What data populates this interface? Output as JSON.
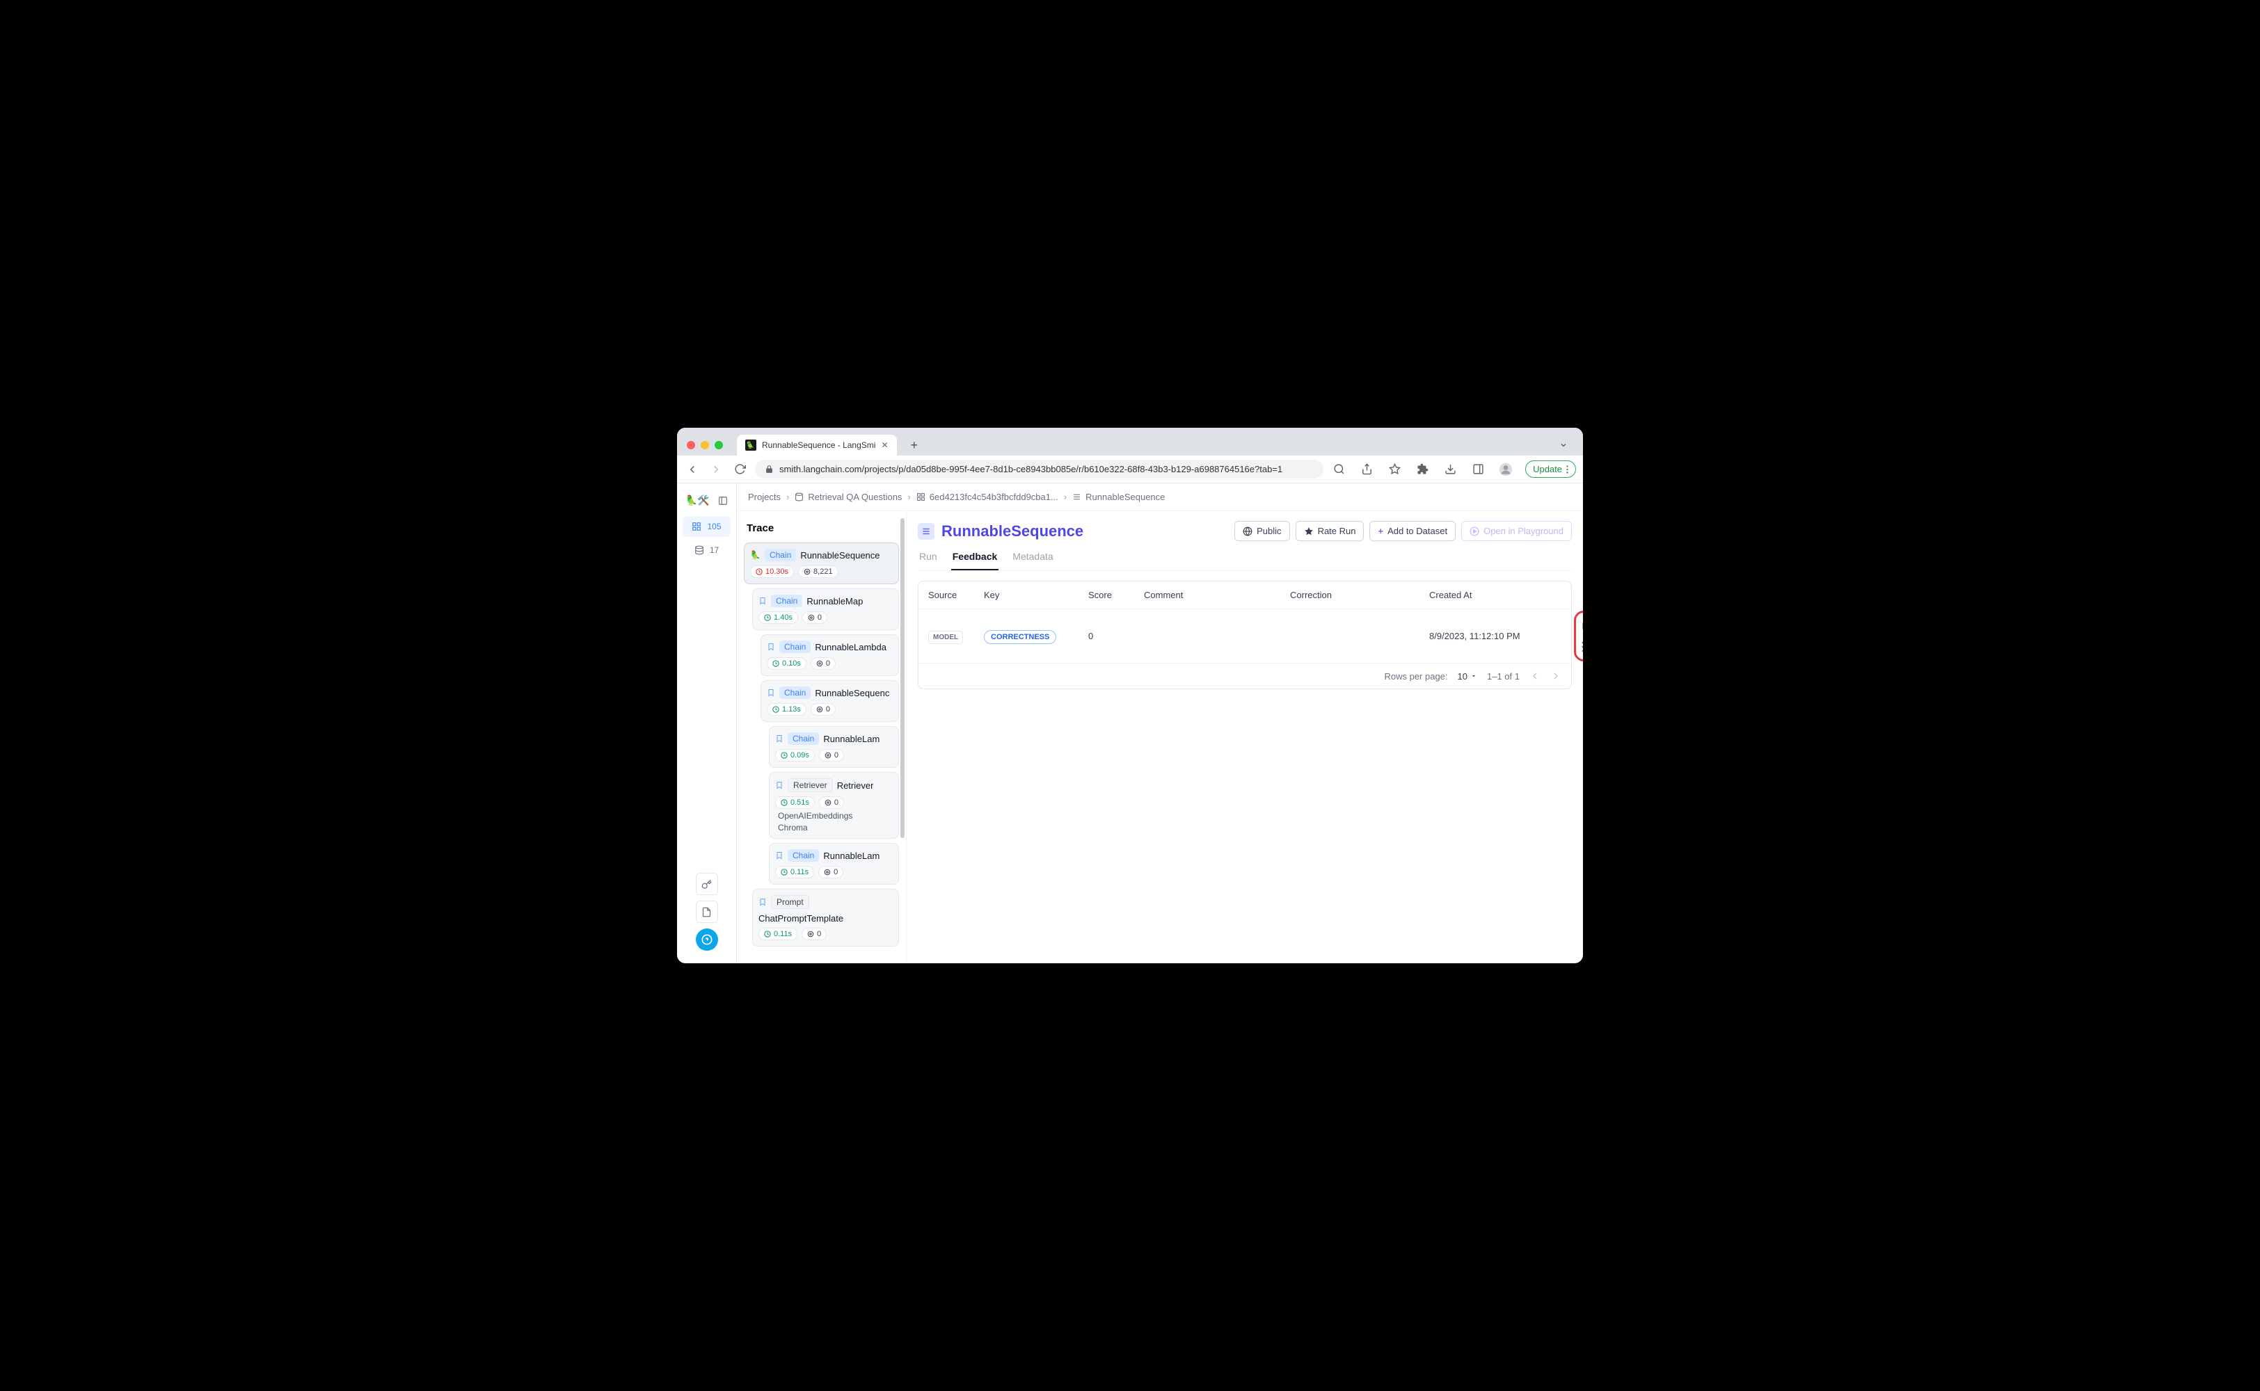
{
  "browser": {
    "tab_title": "RunnableSequence - LangSmi",
    "url": "smith.langchain.com/projects/p/da05d8be-995f-4ee7-8d1b-ce8943bb085e/r/b610e322-68f8-43b3-b129-a6988764516e?tab=1",
    "update_label": "Update"
  },
  "rail": {
    "item1_count": "105",
    "item2_count": "17"
  },
  "breadcrumbs": {
    "projects": "Projects",
    "dataset": "Retrieval QA Questions",
    "run_id": "6ed4213fc4c54b3fbcfdd9cba1...",
    "current": "RunnableSequence"
  },
  "trace": {
    "title": "Trace",
    "root": {
      "kind": "Chain",
      "name": "RunnableSequence",
      "time": "10.30s",
      "tokens": "8,221"
    },
    "n1": {
      "kind": "Chain",
      "name": "RunnableMap",
      "time": "1.40s",
      "count": "0"
    },
    "n2": {
      "kind": "Chain",
      "name": "RunnableLambda",
      "time": "0.10s",
      "count": "0"
    },
    "n3": {
      "kind": "Chain",
      "name": "RunnableSequenc",
      "time": "1.13s",
      "count": "0"
    },
    "n4": {
      "kind": "Chain",
      "name": "RunnableLam",
      "time": "0.09s",
      "count": "0"
    },
    "n5": {
      "kind": "Retriever",
      "name": "Retriever",
      "time": "0.51s",
      "count": "0",
      "sub1": "OpenAIEmbeddings",
      "sub2": "Chroma"
    },
    "n6": {
      "kind": "Chain",
      "name": "RunnableLam",
      "time": "0.11s",
      "count": "0"
    },
    "n7": {
      "kind": "Prompt",
      "name": "ChatPromptTemplate",
      "time": "0.11s",
      "count": "0"
    }
  },
  "detail": {
    "title": "RunnableSequence",
    "public": "Public",
    "rate": "Rate Run",
    "add": "Add to Dataset",
    "playground": "Open in Playground",
    "tabs": {
      "run": "Run",
      "feedback": "Feedback",
      "metadata": "Metadata"
    },
    "cols": {
      "source": "Source",
      "key": "Key",
      "score": "Score",
      "comment": "Comment",
      "correction": "Correction",
      "created": "Created At"
    },
    "row": {
      "source": "MODEL",
      "key": "CORRECTNESS",
      "score": "0",
      "created": "8/9/2023, 11:12:10 PM"
    },
    "pager": {
      "rpp_label": "Rows per page:",
      "rpp": "10",
      "range": "1–1 of 1"
    }
  }
}
